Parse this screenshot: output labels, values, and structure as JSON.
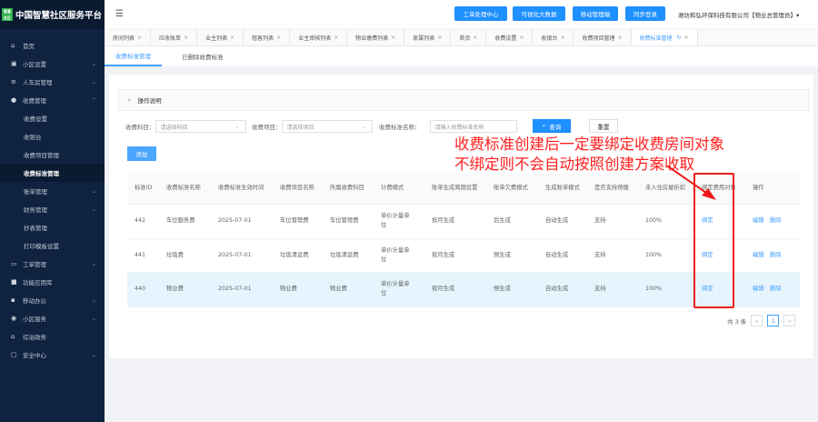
{
  "app": {
    "title": "中国智慧社区服务平台",
    "logo_text": "智慧社区"
  },
  "sidebar": {
    "items": [
      {
        "label": "首页",
        "icon": "home-icon",
        "chev": ""
      },
      {
        "label": "小区设置",
        "icon": "building-icon",
        "chev": "⌄"
      },
      {
        "label": "人车房管理",
        "icon": "database-icon",
        "chev": "⌄"
      },
      {
        "label": "收费管理",
        "icon": "money-bag-icon",
        "chev": "⌃"
      },
      {
        "label": "收费设置",
        "sub": true
      },
      {
        "label": "收银台",
        "sub": true
      },
      {
        "label": "收费项目管理",
        "sub": true
      },
      {
        "label": "收费标准管理",
        "sub": true,
        "active": true
      },
      {
        "label": "账单管理",
        "sub": true,
        "chev": "⌄"
      },
      {
        "label": "财务管理",
        "sub": true,
        "chev": "⌄"
      },
      {
        "label": "抄表管理",
        "sub": true
      },
      {
        "label": "打印模板设置",
        "sub": true
      },
      {
        "label": "工单管理",
        "icon": "ticket-icon",
        "chev": "⌄"
      },
      {
        "label": "功能应用库",
        "icon": "apps-icon",
        "chev": ""
      },
      {
        "label": "移动办公",
        "icon": "briefcase-icon",
        "chev": "⌄"
      },
      {
        "label": "小区服务",
        "icon": "service-icon",
        "chev": "⌄"
      },
      {
        "label": "综治政务",
        "icon": "government-icon",
        "chev": ""
      },
      {
        "label": "安全中心",
        "icon": "shield-icon",
        "chev": "⌄"
      }
    ]
  },
  "header": {
    "buttons": [
      "工单处理中心",
      "可视化大数据",
      "移动管理端",
      "同步登录"
    ],
    "user": "潍坊和弘环保科技有限公司【物业总管理员】▾"
  },
  "tabs": [
    {
      "label": "房间列表"
    },
    {
      "label": "应收账单"
    },
    {
      "label": "业主列表"
    },
    {
      "label": "租客列表"
    },
    {
      "label": "业主审核列表"
    },
    {
      "label": "物业缴费列表"
    },
    {
      "label": "家属列表"
    },
    {
      "label": "首页"
    },
    {
      "label": "收费设置"
    },
    {
      "label": "收银台"
    },
    {
      "label": "收费项目管理"
    },
    {
      "label": "收费标准管理",
      "active": true
    }
  ],
  "subtabs": [
    "收费标准管理",
    "已删除收费标准"
  ],
  "collapse": {
    "label": "操作说明"
  },
  "filters": {
    "subject_label": "收费科目：",
    "subject_placeholder": "请选择科目",
    "project_label": "收费项目：",
    "project_placeholder": "请选择项目",
    "name_label": "收费标准名称：",
    "name_placeholder": "请输入收费标准名称",
    "search_label": "查询",
    "reset_label": "重置"
  },
  "add_label": "添加",
  "table": {
    "headers": [
      "标准ID",
      "收费标准名称",
      "收费标准生效时间",
      "收费项目名称",
      "所属收费科目",
      "计费模式",
      "账单生成周期设置",
      "账单欠费模式",
      "生成账单模式",
      "是否支持预缴",
      "未入住房屋折扣",
      "绑定费用对象",
      "操作"
    ],
    "rows": [
      {
        "id": "442",
        "name": "车位服务费",
        "date": "2025-07-01",
        "project": "车位管理费",
        "subject": "车位管理费",
        "mode": "单价计量单位",
        "cycle": "按月生成",
        "arrears": "后生成",
        "gen": "自动生成",
        "prepay": "支持",
        "discount": "100%",
        "bind": "绑定",
        "edit": "编辑",
        "del": "删除"
      },
      {
        "id": "441",
        "name": "垃圾费",
        "date": "2025-07-01",
        "project": "垃圾清运费",
        "subject": "垃圾清运费",
        "mode": "单价计量单位",
        "cycle": "按月生成",
        "arrears": "预生成",
        "gen": "自动生成",
        "prepay": "支持",
        "discount": "100%",
        "bind": "绑定",
        "edit": "编辑",
        "del": "删除"
      },
      {
        "id": "440",
        "name": "物业费",
        "date": "2025-07-01",
        "project": "物业费",
        "subject": "物业费",
        "mode": "单价计量单位",
        "cycle": "按月生成",
        "arrears": "预生成",
        "gen": "自动生成",
        "prepay": "支持",
        "discount": "100%",
        "bind": "绑定",
        "edit": "编辑",
        "del": "删除"
      }
    ]
  },
  "pagination": {
    "total": "共 3 条",
    "current": "1",
    "prev": "<",
    "next": ">"
  },
  "annotation": {
    "line1": "收费标准创建后一定要绑定收费房间对象",
    "line2": "不绑定则不会自动按照创建方案收取",
    "color": "#ff2020"
  }
}
